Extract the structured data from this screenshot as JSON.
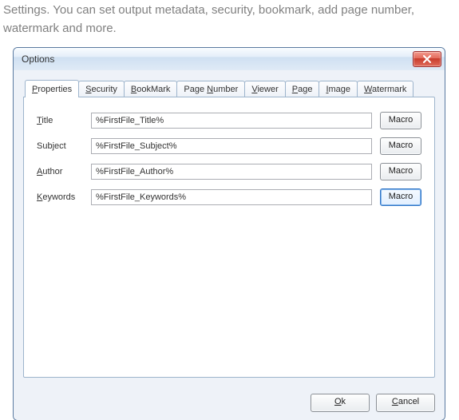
{
  "page_text": "Settings. You can set output metadata, security, bookmark, add page number, watermark and more.",
  "window": {
    "title": "Options",
    "close_icon": "close-icon"
  },
  "tabs": [
    {
      "label_pre": "",
      "label_ul": "P",
      "label_post": "roperties",
      "active": true
    },
    {
      "label_pre": "",
      "label_ul": "S",
      "label_post": "ecurity",
      "active": false
    },
    {
      "label_pre": "",
      "label_ul": "B",
      "label_post": "ookMark",
      "active": false
    },
    {
      "label_pre": "Page ",
      "label_ul": "N",
      "label_post": "umber",
      "active": false
    },
    {
      "label_pre": "",
      "label_ul": "V",
      "label_post": "iewer",
      "active": false
    },
    {
      "label_pre": "",
      "label_ul": "P",
      "label_post": "age",
      "active": false
    },
    {
      "label_pre": "",
      "label_ul": "I",
      "label_post": "mage",
      "active": false
    },
    {
      "label_pre": "",
      "label_ul": "W",
      "label_post": "atermark",
      "active": false
    }
  ],
  "fields": {
    "title": {
      "label_ul": "T",
      "label_rest": "itle",
      "value": "%FirstFile_Title%",
      "macro": "Macro"
    },
    "subject": {
      "label_ul": "",
      "label_rest": "Subject",
      "value": "%FirstFile_Subject%",
      "macro": "Macro"
    },
    "author": {
      "label_ul": "A",
      "label_rest": "uthor",
      "value": "%FirstFile_Author%",
      "macro": "Macro"
    },
    "keywords": {
      "label_ul": "K",
      "label_rest": "eywords",
      "value": "%FirstFile_Keywords%",
      "macro": "Macro",
      "focused": true
    }
  },
  "footer": {
    "ok": {
      "ul": "O",
      "rest": "k"
    },
    "cancel": {
      "ul": "C",
      "rest": "ancel"
    }
  }
}
